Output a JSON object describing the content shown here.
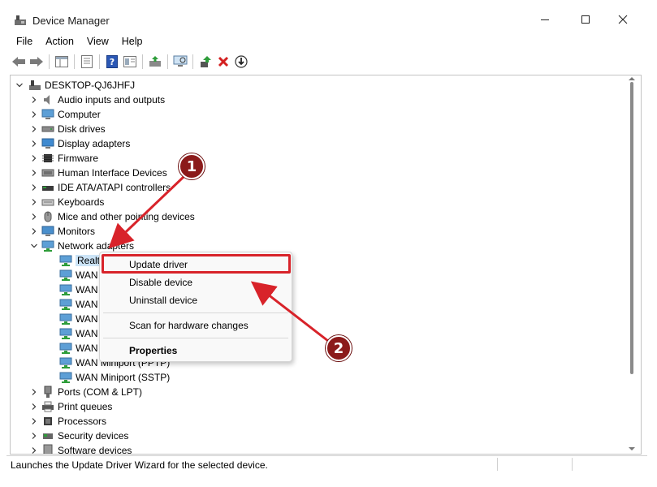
{
  "window": {
    "title": "Device Manager"
  },
  "menu": [
    "File",
    "Action",
    "View",
    "Help"
  ],
  "toolbar_icons": [
    "back-arrow-icon",
    "forward-arrow-icon",
    "show-hide-tree-icon",
    "properties-icon",
    "help-icon",
    "view-icon",
    "update-driver-icon",
    "scan-hardware-icon",
    "enable-device-icon",
    "uninstall-icon",
    "download-icon"
  ],
  "tree": {
    "root": "DESKTOP-QJ6JHFJ",
    "categories_top": [
      "Audio inputs and outputs",
      "Computer",
      "Disk drives",
      "Display adapters",
      "Firmware",
      "Human Interface Devices",
      "IDE ATA/ATAPI controllers",
      "Keyboards",
      "Mice and other pointing devices",
      "Monitors",
      "Network adapters"
    ],
    "network_children": [
      "Realt",
      "WAN",
      "WAN",
      "WAN",
      "WAN",
      "WAN",
      "WAN",
      "WAN Miniport (PPTP)",
      "WAN Miniport (SSTP)"
    ],
    "categories_bottom": [
      "Ports (COM & LPT)",
      "Print queues",
      "Processors",
      "Security devices",
      "Software devices"
    ]
  },
  "context_menu": {
    "update_driver": "Update driver",
    "disable_device": "Disable device",
    "uninstall_device": "Uninstall device",
    "scan_hardware": "Scan for hardware changes",
    "properties": "Properties"
  },
  "annotations": {
    "badge_1": "1",
    "badge_2": "2",
    "color": "#d8232a"
  },
  "status": {
    "text": "Launches the Update Driver Wizard for the selected device."
  }
}
